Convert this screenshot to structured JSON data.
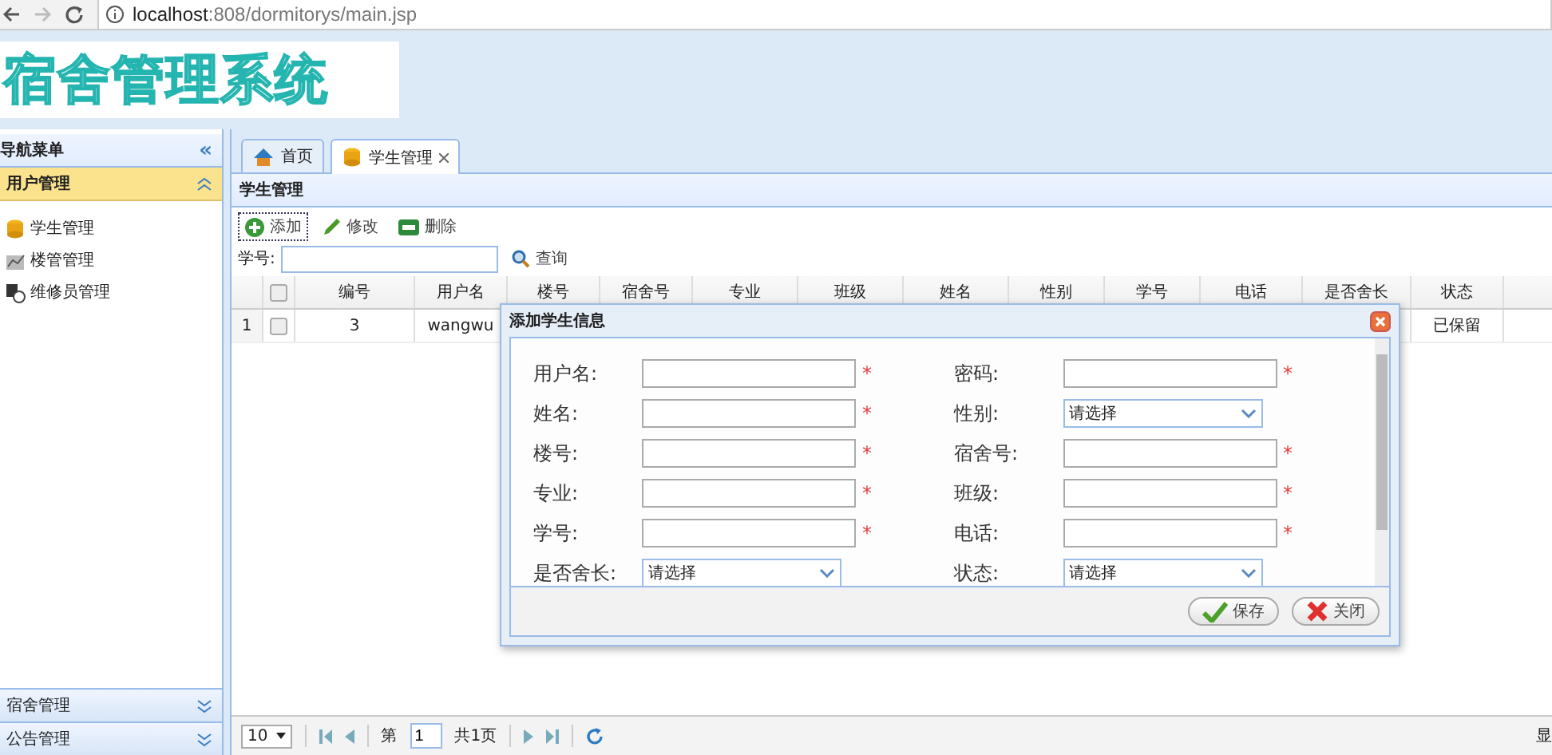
{
  "browser": {
    "url_host": "localhost",
    "url_path": ":808/dormitorys/main.jsp"
  },
  "header": {
    "logo": "宿舍管理系统"
  },
  "sidebar": {
    "title": "导航菜单",
    "collapse": "«",
    "groups": [
      {
        "label": "用户管理",
        "expanded": true,
        "items": [
          {
            "label": "学生管理",
            "kind": "coins"
          },
          {
            "label": "楼管管理",
            "kind": "chart"
          },
          {
            "label": "维修员管理",
            "kind": "person"
          }
        ]
      },
      {
        "label": "宿舍管理",
        "expanded": false
      },
      {
        "label": "公告管理",
        "expanded": false
      }
    ]
  },
  "tabs": [
    {
      "label": "首页",
      "kind": "home",
      "closable": false,
      "selected": false
    },
    {
      "label": "学生管理",
      "kind": "coins",
      "closable": true,
      "selected": true
    }
  ],
  "panel_title": "学生管理",
  "toolbar": [
    {
      "label": "添加",
      "kind": "add",
      "focused": true
    },
    {
      "label": "修改",
      "kind": "edit",
      "focused": false
    },
    {
      "label": "删除",
      "kind": "remove",
      "focused": false
    }
  ],
  "search": {
    "label": "学号:",
    "button": "查询"
  },
  "table": {
    "all_checked": false,
    "columns": [
      "编号",
      "用户名",
      "楼号",
      "宿舍号",
      "专业",
      "班级",
      "姓名",
      "性别",
      "学号",
      "电话",
      "是否舍长",
      "状态"
    ],
    "rows": [
      {
        "index": "1",
        "checked": false,
        "cells": [
          "3",
          "wangwu",
          "",
          "",
          "",
          "",
          "",
          "",
          "",
          "",
          "",
          "已保留"
        ]
      }
    ]
  },
  "pager": {
    "page_size": "10",
    "page_prefix": "第",
    "page": "1",
    "page_total": "共1页",
    "info": "显"
  },
  "dialog": {
    "title": "添加学生信息",
    "fields": [
      {
        "label": "用户名:",
        "kind": "text",
        "mark": "*"
      },
      {
        "label": "密码:",
        "kind": "text",
        "mark": "*"
      },
      {
        "label": "姓名:",
        "kind": "text",
        "mark": "*"
      },
      {
        "label": "性别:",
        "kind": "select",
        "value": "请选择"
      },
      {
        "label": "楼号:",
        "kind": "text",
        "mark": "*"
      },
      {
        "label": "宿舍号:",
        "kind": "text",
        "mark": "*"
      },
      {
        "label": "专业:",
        "kind": "text",
        "mark": "*"
      },
      {
        "label": "班级:",
        "kind": "text",
        "mark": "*"
      },
      {
        "label": "学号:",
        "kind": "text",
        "mark": "*"
      },
      {
        "label": "电话:",
        "kind": "text",
        "mark": "*"
      },
      {
        "label": "是否舍长:",
        "kind": "select",
        "value": "请选择"
      },
      {
        "label": "状态:",
        "kind": "select",
        "value": "请选择"
      }
    ],
    "buttons": [
      {
        "label": "保存",
        "kind": "save"
      },
      {
        "label": "关闭",
        "kind": "close"
      }
    ]
  }
}
